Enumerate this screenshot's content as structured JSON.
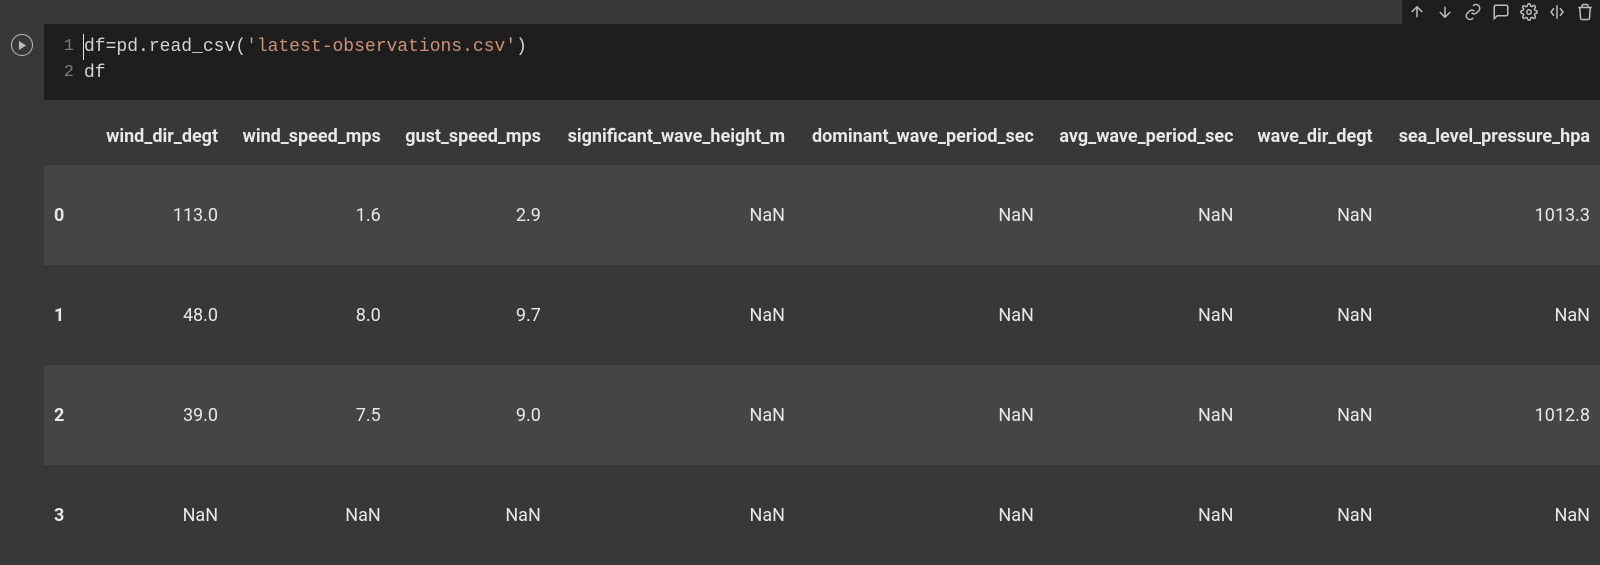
{
  "toolbar_icons": {
    "up": "arrow-up-icon",
    "down": "arrow-down-icon",
    "link": "link-icon",
    "comment": "comment-icon",
    "settings": "gear-icon",
    "mirror": "mirror-icon",
    "delete": "trash-icon"
  },
  "code": {
    "lines": [
      {
        "num": "1",
        "tokens": "df = pd.read_csv('latest-observations.csv')"
      },
      {
        "num": "2",
        "tokens": "df"
      }
    ],
    "line1": {
      "num": "1",
      "var": "df",
      "eq": " = ",
      "mod": "pd",
      "dot": ".",
      "fn": "read_csv",
      "lp": "(",
      "str": "'latest-observations.csv'",
      "rp": ")"
    },
    "line2": {
      "num": "2",
      "var": "df"
    }
  },
  "dataframe": {
    "columns": [
      "wind_dir_degt",
      "wind_speed_mps",
      "gust_speed_mps",
      "significant_wave_height_m",
      "dominant_wave_period_sec",
      "avg_wave_period_sec",
      "wave_dir_degt",
      "sea_level_pressure_hpa"
    ],
    "rows": [
      {
        "idx": "0",
        "cells": [
          "113.0",
          "1.6",
          "2.9",
          "NaN",
          "NaN",
          "NaN",
          "NaN",
          "1013.3"
        ]
      },
      {
        "idx": "1",
        "cells": [
          "48.0",
          "8.0",
          "9.7",
          "NaN",
          "NaN",
          "NaN",
          "NaN",
          "NaN"
        ]
      },
      {
        "idx": "2",
        "cells": [
          "39.0",
          "7.5",
          "9.0",
          "NaN",
          "NaN",
          "NaN",
          "NaN",
          "1012.8"
        ]
      },
      {
        "idx": "3",
        "cells": [
          "NaN",
          "NaN",
          "NaN",
          "NaN",
          "NaN",
          "NaN",
          "NaN",
          "NaN"
        ]
      }
    ]
  }
}
